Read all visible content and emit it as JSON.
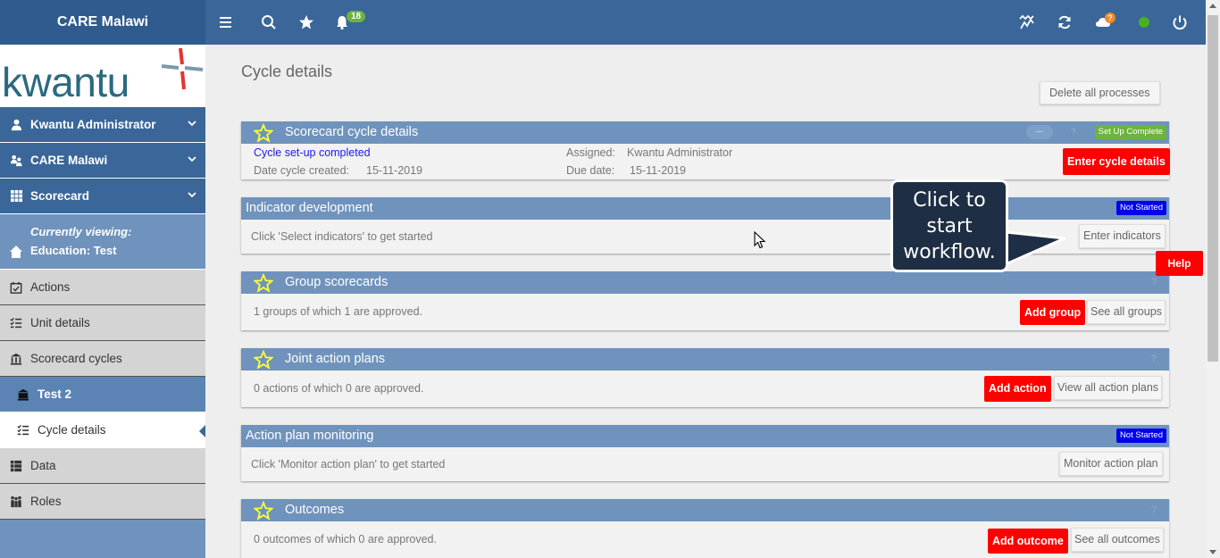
{
  "header": {
    "brand": "CARE Malawi",
    "notification_count": "18",
    "cloud_badge": "?"
  },
  "sidebar": {
    "logo_text": "kwantu",
    "items": [
      {
        "label": "Kwantu Administrator"
      },
      {
        "label": "CARE Malawi"
      },
      {
        "label": "Scorecard"
      },
      {
        "label": "Actions"
      },
      {
        "label": "Unit details"
      },
      {
        "label": "Scorecard cycles"
      },
      {
        "label": "Test 2"
      },
      {
        "label": "Cycle details"
      },
      {
        "label": "Data"
      },
      {
        "label": "Roles"
      }
    ],
    "viewing_line1": "Currently viewing:",
    "viewing_line2": "Education: Test"
  },
  "main": {
    "title": "Cycle details",
    "delete_button": "Delete all processes",
    "panels": {
      "scorecard": {
        "title": "Scorecard cycle details",
        "status": "Set Up Complete",
        "q": "?",
        "dots": "...",
        "link": "Cycle set-up completed",
        "date_created_label": "Date cycle created:",
        "date_created": "15-11-2019",
        "assigned_label": "Assigned:",
        "assigned": "Kwantu Administrator",
        "due_label": "Due date:",
        "due": "15-11-2019",
        "button": "Enter cycle details"
      },
      "indicator": {
        "title": "Indicator development",
        "status": "Not Started",
        "text": "Click 'Select indicators' to get started",
        "button": "Enter indicators"
      },
      "groups": {
        "title": "Group scorecards",
        "q": "?",
        "text": "1 groups of which 1 are approved.",
        "add_button": "Add group",
        "see_button": "See all groups"
      },
      "actions": {
        "title": "Joint action plans",
        "q": "?",
        "text": "0 actions of which 0 are approved.",
        "add_button": "Add action",
        "see_button": "View all action plans"
      },
      "monitoring": {
        "title": "Action plan monitoring",
        "status": "Not Started",
        "text": "Click 'Monitor action plan' to get started",
        "button": "Monitor action plan"
      },
      "outcomes": {
        "title": "Outcomes",
        "q": "?",
        "text": "0 outcomes of which 0 are approved.",
        "add_button": "Add outcome",
        "see_button": "See all outcomes"
      }
    }
  },
  "callout": {
    "line1": "Click to",
    "line2": "start",
    "line3": "workflow."
  },
  "help_button": "Help",
  "colors": {
    "topbar": "#3a6699",
    "panel_header": "#6f93bc",
    "accent_red": "#ff0000",
    "status_green": "#6cb33f",
    "status_blue": "#0000ee"
  }
}
